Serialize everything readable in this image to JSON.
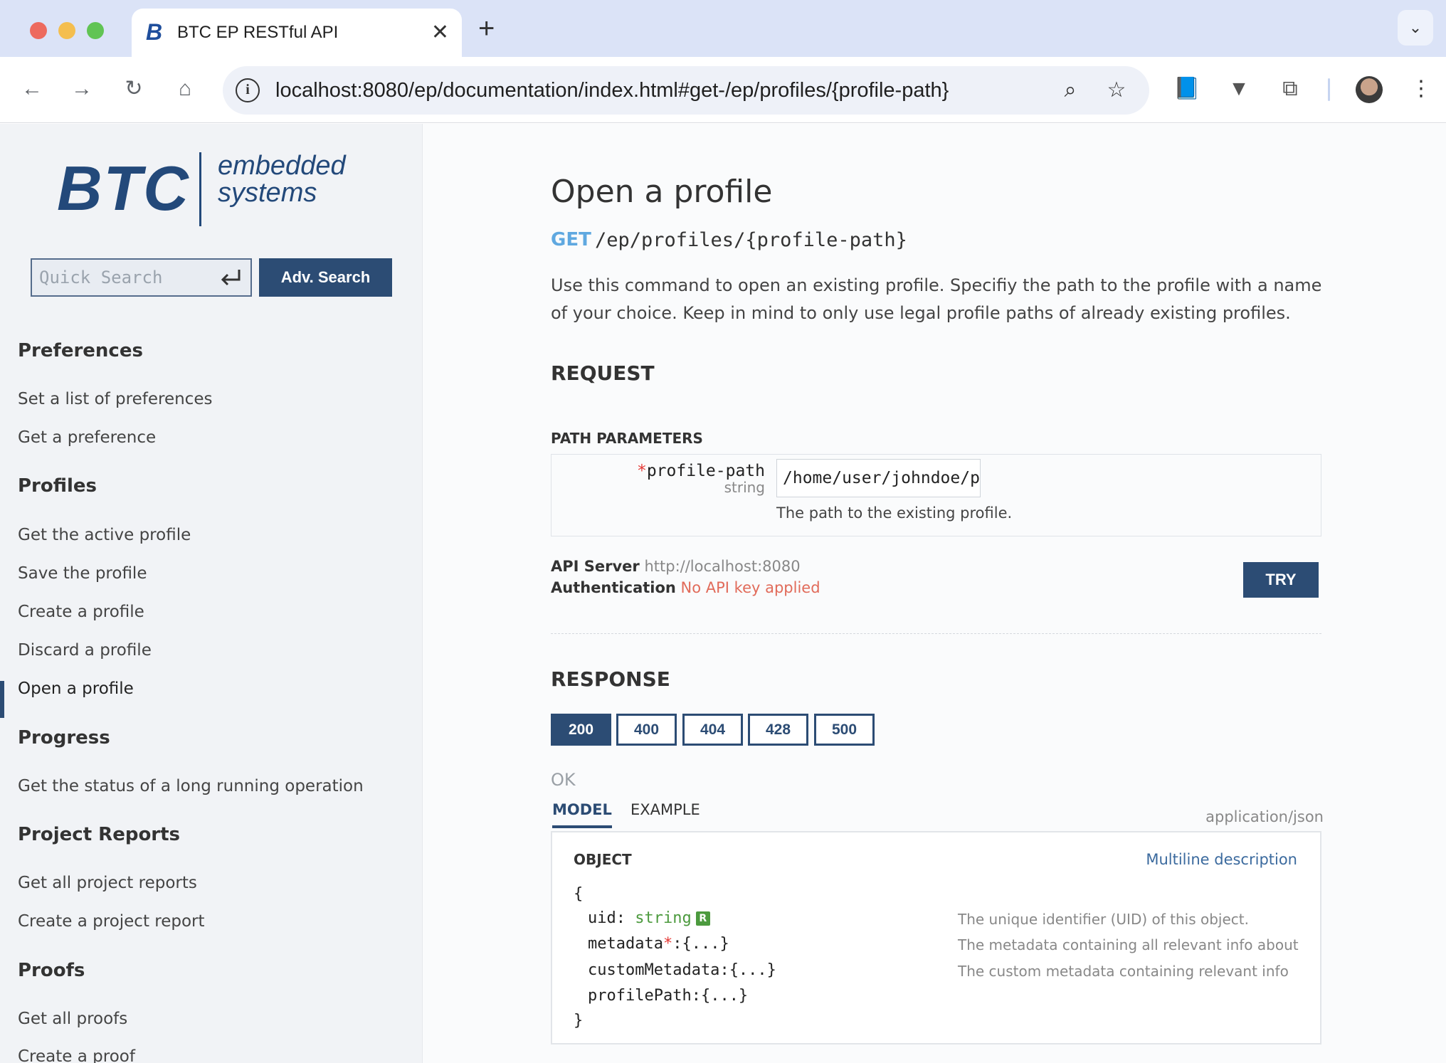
{
  "browser": {
    "tab_title": "BTC EP RESTful API",
    "tab_favicon": "B",
    "tab_close": "✕",
    "new_tab": "+",
    "url": "localhost:8080/ep/documentation/index.html#get-/ep/profiles/{profile-path}"
  },
  "sidebar": {
    "logo": {
      "brand": "BTC",
      "line1": "embedded",
      "line2": "systems"
    },
    "search_placeholder": "Quick Search",
    "adv_search_label": "Adv. Search",
    "groups": [
      {
        "title": "Preferences",
        "items": [
          "Set a list of preferences",
          "Get a preference"
        ]
      },
      {
        "title": "Profiles",
        "items": [
          "Get the active profile",
          "Save the profile",
          "Create a profile",
          "Discard a profile",
          "Open a profile"
        ]
      },
      {
        "title": "Progress",
        "items": [
          "Get the status of a long running operation"
        ]
      },
      {
        "title": "Project Reports",
        "items": [
          "Get all project reports",
          "Create a project report"
        ]
      },
      {
        "title": "Proofs",
        "items": [
          "Get all proofs",
          "Create a proof"
        ]
      }
    ],
    "active_item": "Open a profile"
  },
  "main": {
    "title": "Open a profile",
    "method": "GET",
    "path": "/ep/profiles/{profile-path}",
    "description": "Use this command to open an existing profile. Specifiy the path to the profile with a name of your choice. Keep in mind to only use legal profile paths of already existing profiles.",
    "request_heading": "REQUEST",
    "path_params_heading": "PATH PARAMETERS",
    "param": {
      "required_mark": "*",
      "name": "profile-path",
      "type": "string",
      "value": "/home/user/johndoe/pr",
      "help": "The path to the existing profile."
    },
    "api_server_label": "API Server",
    "api_server_value": "http://localhost:8080",
    "auth_label": "Authentication",
    "auth_value": "No API key applied",
    "try_label": "TRY",
    "response_heading": "RESPONSE",
    "status_codes": [
      "200",
      "400",
      "404",
      "428",
      "500"
    ],
    "active_code": "200",
    "status_text": "OK",
    "tab_model": "MODEL",
    "tab_example": "EXAMPLE",
    "content_type": "application/json",
    "model": {
      "kind": "OBJECT",
      "multiline_label": "Multiline description",
      "open_brace": "{",
      "close_brace": "}",
      "fields": [
        {
          "name": "uid",
          "sep": ": ",
          "type": "string",
          "badge": "R",
          "desc": "The unique identifier (UID) of this object."
        },
        {
          "name": "metadata",
          "req": "*",
          "sep": ":",
          "type": "{...}",
          "desc": "The metadata containing all relevant info about"
        },
        {
          "name": "customMetadata",
          "sep": ":",
          "type": "{...}",
          "desc": "The custom metadata containing relevant info"
        },
        {
          "name": "profilePath",
          "sep": ":",
          "type": "{...}",
          "desc": ""
        }
      ]
    }
  }
}
